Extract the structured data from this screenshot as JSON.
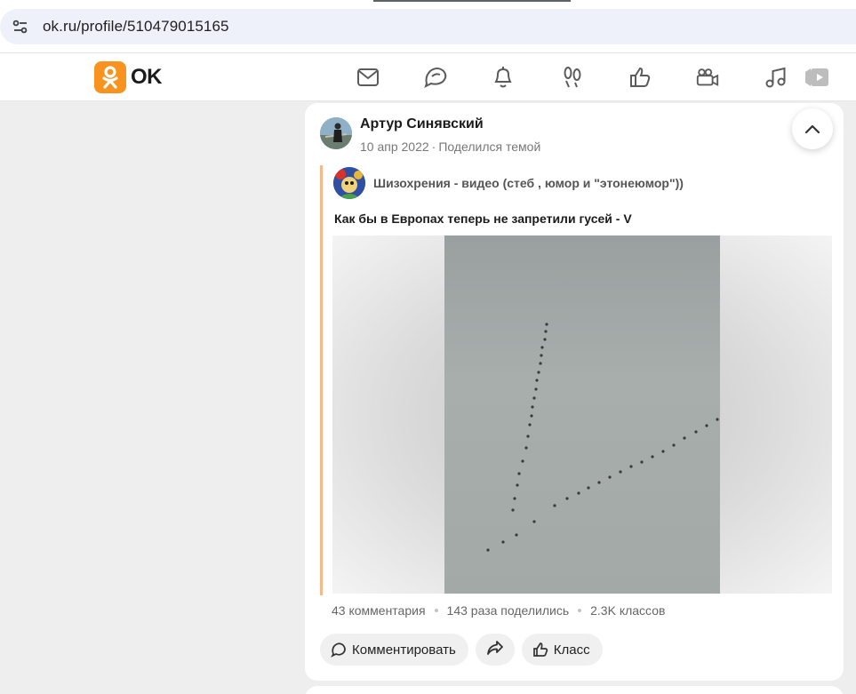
{
  "browser": {
    "url": "ok.ru/profile/510479015165"
  },
  "header": {
    "logo_text": "OK",
    "brand_color": "#f7931e",
    "nav_icons": [
      "mail-icon",
      "chat-icon",
      "bell-icon",
      "footprints-icon",
      "like-icon",
      "video-camera-icon",
      "music-icon",
      "video-play-icon"
    ]
  },
  "post": {
    "author": "Артур Синявский",
    "date": "10 апр 2022",
    "action": "Поделился темой",
    "group_name": "Шизохрения - видео (стеб , юмор и \"этонеюмор\"))",
    "topic_title": "Как бы в Европах теперь не запретили гусей - V",
    "stats": {
      "comments": "43 комментария",
      "shares": "143 раза поделились",
      "likes": "2.3K классов"
    },
    "actions": {
      "comment": "Комментировать",
      "like": "Класс"
    }
  },
  "colors": {
    "accent": "#f7931e",
    "share_border": "#f7b98a",
    "page_bg": "#eeeeee"
  }
}
